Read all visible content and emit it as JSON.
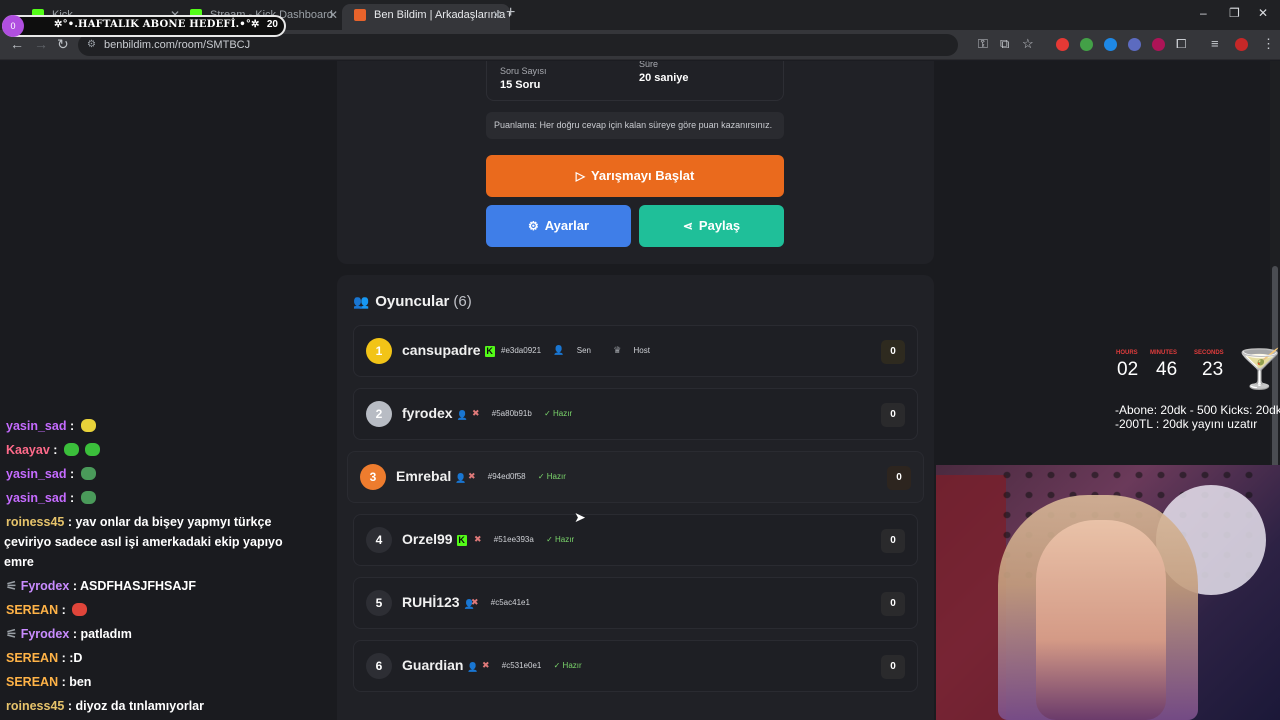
{
  "browser": {
    "tabs": [
      {
        "title": "Kick",
        "favicon_color": "#53fc18"
      },
      {
        "title": "Stream - Kick Dashboard",
        "favicon_color": "#53fc18"
      },
      {
        "title": "Ben Bildim | Arkadaşlarınla Onli",
        "favicon_color": "#e8632b"
      }
    ],
    "url": "benbildim.com/room/SMTBCJ",
    "new_tab_icon": "+",
    "controls": {
      "minimize": "–",
      "restore": "❐",
      "close": "✕"
    }
  },
  "stream_goal": {
    "label": "✲°•.HAFTALIK ABONE HEDEFİ.•°✲",
    "count": "20",
    "bubble": "0"
  },
  "room": {
    "question_count_label": "Soru Sayısı",
    "question_count_value": "15 Soru",
    "time_label": "Süre",
    "time_value": "20 saniye",
    "scoring_note": "Puanlama: Her doğru cevap için kalan süreye göre puan kazanırsınız.",
    "start_button": "Yarışmayı Başlat",
    "settings_button": "Ayarlar",
    "share_button": "Paylaş"
  },
  "players": {
    "title": "Oyuncular",
    "count": "(6)",
    "list": [
      {
        "rank": "1",
        "name": "cansupadre",
        "kick": "K",
        "id": "#e3da0921",
        "tag1": "Sen",
        "tag2": "Host",
        "score": "0"
      },
      {
        "rank": "2",
        "name": "fyrodex",
        "id": "#5a80b91b",
        "status": "Hazır",
        "score": "0"
      },
      {
        "rank": "3",
        "name": "Emrebal",
        "id": "#94ed0f58",
        "status": "Hazır",
        "score": "0"
      },
      {
        "rank": "4",
        "name": "Orzel99",
        "kick": "K",
        "id": "#51ee393a",
        "status": "Hazır",
        "score": "0"
      },
      {
        "rank": "5",
        "name": "RUHİ123",
        "id": "#c5ac41e1",
        "score": "0"
      },
      {
        "rank": "6",
        "name": "Guardian",
        "id": "#c531e0e1",
        "status": "Hazır",
        "score": "0"
      }
    ]
  },
  "chat": [
    {
      "user": "yasin_sad",
      "text": "",
      "color": "#c56bff"
    },
    {
      "user": "Kaayav",
      "text": "",
      "color": "#ff6a8a"
    },
    {
      "user": "yasin_sad",
      "text": "",
      "color": "#c56bff"
    },
    {
      "user": "yasin_sad",
      "text": "",
      "color": "#c56bff"
    },
    {
      "user": "roiness45",
      "text": "yav onlar da bişey yapmyı türkçe",
      "color": "#e6c36b"
    },
    {
      "user": "",
      "text": "çeviriyo sadece asıl işi amerkadaki ekip yapıyo",
      "color": "#fff"
    },
    {
      "user": "",
      "text": "emre",
      "color": "#fff"
    },
    {
      "user": "Fyrodex",
      "text": "ASDFHASJFHSAJF",
      "color": "#c98cff"
    },
    {
      "user": "SEREAN",
      "text": "",
      "color": "#ffb347"
    },
    {
      "user": "Fyrodex",
      "text": "patladım",
      "color": "#c98cff"
    },
    {
      "user": "SEREAN",
      "text": ":D",
      "color": "#ffb347"
    },
    {
      "user": "SEREAN",
      "text": "ben",
      "color": "#ffb347"
    },
    {
      "user": "roiness45",
      "text": "diyoz da tınlamıyorlar",
      "color": "#e6c36b"
    }
  ],
  "timer": {
    "hours_label": "HOURS",
    "minutes_label": "MINUTES",
    "seconds_label": "SECONDS",
    "hours": "02",
    "minutes": "46",
    "seconds": "23"
  },
  "goals_note": [
    "-Abone: 20dk - 500 Kicks: 20dk",
    "-200TL : 20dk yayını uzatır"
  ]
}
